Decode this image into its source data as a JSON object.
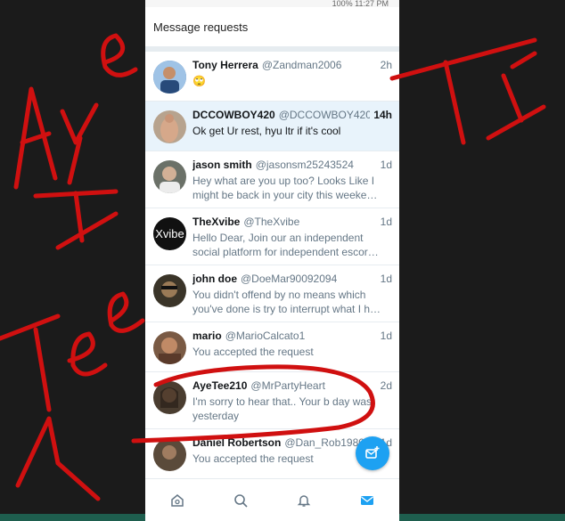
{
  "status_bar": {
    "text": "100% 11:27 PM"
  },
  "header": {
    "title": "Message requests"
  },
  "messages": [
    {
      "name": "Tony Herrera",
      "handle": "@Zandman2006",
      "time": "2h",
      "text": "🙄",
      "highlighted": false,
      "avatar_color": "#3f6fa8"
    },
    {
      "name": "DCCOWBOY420",
      "handle": "@DCCOWBOY4201",
      "time": "14h",
      "text": "Ok get Ur rest, hyu ltr if it's cool",
      "highlighted": true,
      "avatar_color": "#c79a78"
    },
    {
      "name": "jason smith",
      "handle": "@jasonsm25243524",
      "time": "1d",
      "text": "Hey what are you up too? Looks Like I might be back in your city this weeke…",
      "highlighted": false,
      "avatar_color": "#8a8f7a"
    },
    {
      "name": "TheXvibe",
      "handle": "@TheXvibe",
      "time": "1d",
      "text": "Hello Dear, Join our an independent social platform for independent escor…",
      "highlighted": false,
      "avatar_color": "#111111",
      "avatar_text": "Xvibe"
    },
    {
      "name": "john doe",
      "handle": "@DoeMar90092094",
      "time": "1d",
      "text": "You didn't offend by no means which you've done is try to interrupt what I h…",
      "highlighted": false,
      "avatar_color": "#4a4030"
    },
    {
      "name": "mario",
      "handle": "@MarioCalcato1",
      "time": "1d",
      "text": "You accepted the request",
      "highlighted": false,
      "avatar_color": "#8a5a40"
    },
    {
      "name": "AyeTee210",
      "handle": "@MrPartyHeart",
      "time": "2d",
      "text": "I'm sorry to hear that.. Your b day was yesterday",
      "highlighted": false,
      "avatar_color": "#5a4a3a"
    },
    {
      "name": "Daniel Robertson",
      "handle": "@Dan_Rob1980",
      "time": "1d",
      "text": "You accepted the request",
      "highlighted": false,
      "avatar_color": "#6a5a4a"
    }
  ],
  "bottom_nav": [
    "home-icon",
    "search-icon",
    "notifications-icon",
    "messages-icon"
  ],
  "colors": {
    "accent": "#1da1f2",
    "highlight_row": "#e8f3fb",
    "scribble": "#d01010"
  }
}
